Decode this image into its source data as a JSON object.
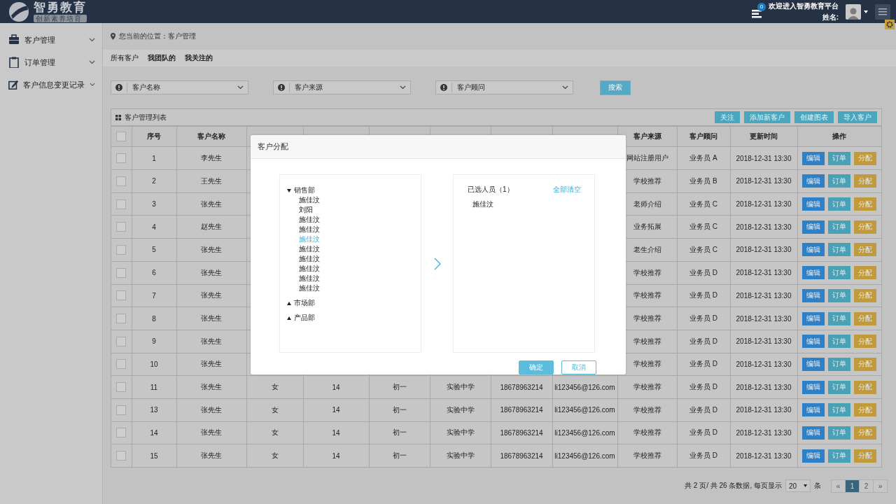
{
  "header": {
    "logo_title": "智勇教育",
    "logo_subtitle": "创新素养培育",
    "notifications": "0",
    "welcome": "欢迎进入智勇教育平台",
    "user_label": "姓名:"
  },
  "sidebar": {
    "items": [
      {
        "label": "客户管理",
        "kind": "briefcase"
      },
      {
        "label": "订单管理",
        "kind": "clipboard"
      },
      {
        "label": "客户信息变更记录",
        "kind": "edit"
      }
    ]
  },
  "breadcrumb": "您当前的位置：客户管理",
  "tabs": [
    {
      "label": "所有客户",
      "selected": true
    },
    {
      "label": "我团队的",
      "selected": false
    },
    {
      "label": "我关注的",
      "selected": false
    }
  ],
  "filters": [
    {
      "placeholder": "客户名称"
    },
    {
      "placeholder": "客户来源"
    },
    {
      "placeholder": "客户顾问"
    }
  ],
  "search_button": "搜索",
  "table": {
    "title": "客户管理列表",
    "select_all_checked": false,
    "actions": [
      "关注",
      "添加新客户",
      "创建图表",
      "导入客户"
    ],
    "columns": [
      "序号",
      "客户名称",
      null,
      null,
      null,
      null,
      null,
      null,
      "客户来源",
      "客户顾问",
      "更新时间",
      "操作"
    ],
    "rows": [
      {
        "checked": false,
        "cells": [
          "1",
          "李先生",
          null,
          null,
          null,
          null,
          null,
          null,
          "网站注册用户",
          "业务员 A",
          "2018-12-31 13:30"
        ],
        "actions": [
          "编辑",
          "订单",
          "分配"
        ]
      },
      {
        "checked": false,
        "cells": [
          "2",
          "王先生",
          null,
          null,
          null,
          null,
          null,
          null,
          "学校推荐",
          "业务员 B",
          "2018-12-31 13:30"
        ],
        "actions": [
          "编辑",
          "订单",
          "分配"
        ]
      },
      {
        "checked": false,
        "cells": [
          "3",
          "张先生",
          null,
          null,
          null,
          null,
          null,
          null,
          "老师介绍",
          "业务员 C",
          "2018-12-31 13:30"
        ],
        "actions": [
          "编辑",
          "订单",
          "分配"
        ]
      },
      {
        "checked": false,
        "cells": [
          "4",
          "赵先生",
          null,
          null,
          null,
          null,
          null,
          null,
          "业务拓展",
          "业务员 C",
          "2018-12-31 13:30"
        ],
        "actions": [
          "编辑",
          "订单",
          "分配"
        ]
      },
      {
        "checked": false,
        "cells": [
          "5",
          "张先生",
          null,
          null,
          null,
          null,
          null,
          null,
          "老生介绍",
          "业务员 C",
          "2018-12-31 13:30"
        ],
        "actions": [
          "编辑",
          "订单",
          "分配"
        ]
      },
      {
        "checked": false,
        "cells": [
          "6",
          "张先生",
          null,
          null,
          null,
          null,
          null,
          null,
          "学校推荐",
          "业务员 D",
          "2018-12-31 13:30"
        ],
        "actions": [
          "编辑",
          "订单",
          "分配"
        ]
      },
      {
        "checked": false,
        "cells": [
          "7",
          "张先生",
          null,
          null,
          null,
          null,
          null,
          null,
          "学校推荐",
          "业务员 D",
          "2018-12-31 13:30"
        ],
        "actions": [
          "编辑",
          "订单",
          "分配"
        ]
      },
      {
        "checked": false,
        "cells": [
          "8",
          "张先生",
          null,
          null,
          null,
          null,
          null,
          null,
          "学校推荐",
          "业务员 D",
          "2018-12-31 13:30"
        ],
        "actions": [
          "编辑",
          "订单",
          "分配"
        ]
      },
      {
        "checked": false,
        "cells": [
          "9",
          "张先生",
          null,
          null,
          null,
          null,
          null,
          null,
          "学校推荐",
          "业务员 D",
          "2018-12-31 13:30"
        ],
        "actions": [
          "编辑",
          "订单",
          "分配"
        ]
      },
      {
        "checked": false,
        "cells": [
          "10",
          "张先生",
          null,
          null,
          null,
          null,
          null,
          null,
          "学校推荐",
          "业务员 D",
          "2018-12-31 13:30"
        ],
        "actions": [
          "编辑",
          "订单",
          "分配"
        ]
      },
      {
        "checked": false,
        "cells": [
          "11",
          "张先生",
          "女",
          "14",
          "初一",
          "实验中学",
          "18678963214",
          "li123456@126.com",
          "学校推荐",
          "业务员 D",
          "2018-12-31 13:30"
        ],
        "actions": [
          "编辑",
          "订单",
          "分配"
        ]
      },
      {
        "checked": false,
        "cells": [
          "13",
          "张先生",
          "女",
          "14",
          "初一",
          "实验中学",
          "18678963214",
          "li123456@126.com",
          "学校推荐",
          "业务员 D",
          "2018-12-31 13:30"
        ],
        "actions": [
          "编辑",
          "订单",
          "分配"
        ]
      },
      {
        "checked": false,
        "cells": [
          "14",
          "张先生",
          "女",
          "14",
          "初一",
          "实验中学",
          "18678963214",
          "li123456@126.com",
          "学校推荐",
          "业务员 D",
          "2018-12-31 13:30"
        ],
        "actions": [
          "编辑",
          "订单",
          "分配"
        ]
      },
      {
        "checked": false,
        "cells": [
          "15",
          "张先生",
          "女",
          "14",
          "初一",
          "实验中学",
          "18678963214",
          "li123456@126.com",
          "学校推荐",
          "业务员 D",
          "2018-12-31 13:30"
        ],
        "actions": [
          "编辑",
          "订单",
          "分配"
        ]
      }
    ]
  },
  "pagination": {
    "summary": "共 2 页/ 共 26 条数据, 每页显示",
    "page_size": "20",
    "unit": "条",
    "pages": [
      {
        "label": "«",
        "selected": false
      },
      {
        "label": "1",
        "selected": true
      },
      {
        "label": "2",
        "selected": false
      },
      {
        "label": "»",
        "selected": false
      }
    ]
  },
  "dialog": {
    "title": "客户分配",
    "tree": [
      {
        "label": "销售部",
        "expanded": true,
        "children": [
          {
            "label": "施佳汶",
            "selected": false
          },
          {
            "label": "刘阳",
            "selected": false
          },
          {
            "label": "施佳汶",
            "selected": false
          },
          {
            "label": "施佳汶",
            "selected": false
          },
          {
            "label": "施佳汶",
            "selected": true
          },
          {
            "label": "施佳汶",
            "selected": false
          },
          {
            "label": "施佳汶",
            "selected": false
          },
          {
            "label": "施佳汶",
            "selected": false
          },
          {
            "label": "施佳汶",
            "selected": false
          },
          {
            "label": "施佳汶",
            "selected": false
          }
        ]
      },
      {
        "label": "市场部",
        "expanded": false
      },
      {
        "label": "产品部",
        "expanded": false
      }
    ],
    "selected_title": "已选人员（1）",
    "clear_all": "全部清空",
    "selected_people": [
      "施佳汶"
    ],
    "buttons": [
      {
        "label": "确定",
        "kind": "primary"
      },
      {
        "label": "取消",
        "kind": "secondary"
      }
    ]
  }
}
